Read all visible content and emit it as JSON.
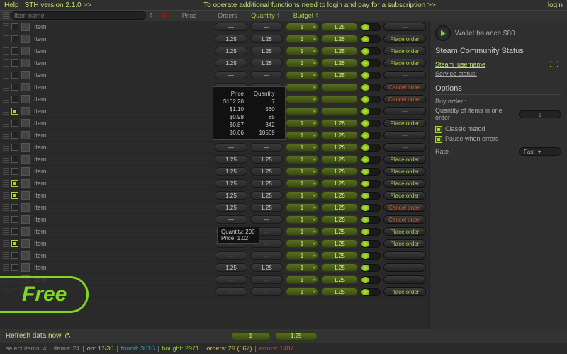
{
  "topbar": {
    "help": "Help",
    "version": "STH version 2.1.0 >>",
    "promo": "To operate additional functions need to login and pay for a subscription >>",
    "login": "login"
  },
  "header": {
    "name_placeholder": "Item name",
    "price": "Price",
    "orders": "Orders",
    "quantity": "Quantity",
    "budget": "Budget"
  },
  "actions": {
    "place": "Place order",
    "cancel": "Cancel order",
    "dash": "—"
  },
  "defaults": {
    "dash": "—",
    "price": "1.25",
    "orders": "1.25",
    "qty": "1",
    "budget": "1.25"
  },
  "rows": [
    {
      "sel": false,
      "p": "—",
      "o": "—",
      "tog": "on",
      "act": "dash"
    },
    {
      "sel": false,
      "tog": "on",
      "act": "place"
    },
    {
      "sel": false,
      "tog": "on",
      "act": "place"
    },
    {
      "sel": false,
      "tog": "on",
      "act": "place"
    },
    {
      "sel": false,
      "p": "—",
      "o": "—",
      "tog": "on",
      "act": "dash"
    },
    {
      "sel": false,
      "p": "",
      "o": "",
      "q": "",
      "b": "",
      "tog": "on",
      "act": "cancel"
    },
    {
      "sel": false,
      "p": "",
      "o": "",
      "q": "",
      "b": "",
      "tog": "on",
      "act": "cancel"
    },
    {
      "sel": true,
      "p": "",
      "o": "",
      "q": "",
      "b": "",
      "tog": "on",
      "act": "dash"
    },
    {
      "sel": false,
      "tog": "on",
      "act": "place"
    },
    {
      "sel": false,
      "p": "—",
      "o": "—",
      "tog": "on",
      "act": "dash"
    },
    {
      "sel": false,
      "p": "—",
      "o": "—",
      "tog": "on",
      "act": "dash"
    },
    {
      "sel": false,
      "tog": "on",
      "act": "place"
    },
    {
      "sel": false,
      "tog": "on",
      "act": "place"
    },
    {
      "sel": true,
      "tog": "on",
      "act": "place"
    },
    {
      "sel": true,
      "tog": "on",
      "act": "place"
    },
    {
      "sel": false,
      "tog": "on",
      "act": "cancel"
    },
    {
      "sel": false,
      "p": "—",
      "o": "—",
      "tog": "on",
      "act": "cancel"
    },
    {
      "sel": false,
      "p": "—",
      "o": "—",
      "tog": "on",
      "act": "place"
    },
    {
      "sel": true,
      "p": "—",
      "o": "—",
      "tog": "on",
      "act": "place"
    },
    {
      "sel": false,
      "p": "—",
      "o": "—",
      "tog": "on",
      "act": "dash"
    },
    {
      "sel": false,
      "tog": "on",
      "act": "dash"
    },
    {
      "sel": false,
      "p": "—",
      "o": "—",
      "tog": "on",
      "act": "dash"
    },
    {
      "sel": false,
      "p": "—",
      "o": "—",
      "tog": "on",
      "act": "place"
    }
  ],
  "item_label": "Item",
  "tooltip1": {
    "h1": "Price",
    "h2": "Quantity",
    "r": [
      [
        "$102.20",
        "7"
      ],
      [
        "$1.10",
        "560"
      ],
      [
        "$0.98",
        "85"
      ],
      [
        "$0.87",
        "342"
      ],
      [
        "$0.66",
        "10569"
      ]
    ]
  },
  "tooltip2": {
    "l1": "Quantity: 290",
    "l2": "Price:   1.02"
  },
  "sidebar": {
    "wallet": "Wallet balance $80",
    "community_title": "Steam Community Status",
    "username": "Steam_username",
    "service": "Service status:",
    "options_title": "Options",
    "buy_order": "Buy order :",
    "qty_label": "Quantity of items in one order",
    "qty_value": "1",
    "classic": "Classic metod",
    "pause": "Pause when errors",
    "rate_label": "Rate :",
    "rate_value": "Fast"
  },
  "free_badge": "Free",
  "bottombar": {
    "refresh": "Refresh data now",
    "qty": "1",
    "budget": "1.25"
  },
  "status": {
    "select": "select items: 4",
    "items": "items: 24",
    "on": "on: 17/30",
    "found": "found: 3016",
    "bought": "bought: 2971",
    "orders": "orders: 29 (567)",
    "errors": "errors: 1487"
  }
}
